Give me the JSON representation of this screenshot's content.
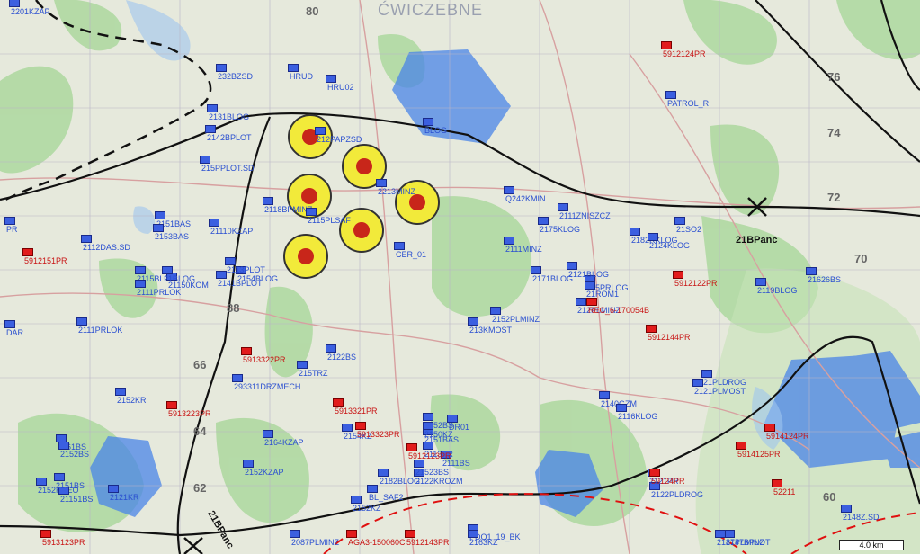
{
  "map": {
    "title_watermark": "ĆWICZEBNE",
    "grid_numbers": [
      "80",
      "76",
      "74",
      "72",
      "70",
      "88",
      "66",
      "64",
      "62",
      "60"
    ],
    "scale_label": "4.0 km"
  },
  "boundary_labels": {
    "right": "21BPanc",
    "bottom": "21BPanc"
  },
  "units_blue": [
    "2201KZAP",
    "232BZSD",
    "HRUD",
    "HRU02",
    "2131BLOG",
    "2142BPLOT",
    "215PPLOT.SD",
    "2151BAS",
    "2118BPMINZ",
    "2115PLSAF",
    "212PAPZSD",
    "2213MINZ",
    "BLOG",
    "CER_01",
    "Q242KMIN",
    "2175KLOG",
    "2111MINZ",
    "2182RKLOG",
    "2152PLMINZ",
    "213KMOST",
    "2112DAS.SD",
    "2153BAS",
    "21110KZAP",
    "2154BLOG",
    "2115BLOG",
    "2111PRLOK",
    "21150KOM",
    "2141BPLOT",
    "2122BS",
    "293311DRZMECH",
    "2152KR",
    "2161BS",
    "2152BS",
    "2164KZAP",
    "2154KZ",
    "2152KREO",
    "21151BS",
    "PATROL_R",
    "2111ZNISZCZ",
    "2121PLMOST",
    "2121KR",
    "2124KLOG",
    "2119BLOG",
    "21626BS",
    "21SO2",
    "21PLDROG",
    "2140GZM",
    "2151BAS",
    "2182BLOG",
    "212PLMINZ",
    "215PRLOG",
    "DAR",
    "PR",
    "21BLOG",
    "2116KLOG",
    "2113PR",
    "2121BLOG",
    "2171BLOG",
    "2122PLDROG",
    "2121PR",
    "2111BS",
    "2113PLOT",
    "21ROM1",
    "2147BPLOT",
    "2151BS",
    "2152BS",
    "2150KZ",
    "2122KROZM",
    "21523BS",
    "2111PRLOK",
    "215TRZ",
    "DR01",
    "BL_SAF2",
    "2152KZ",
    "PDO1_19_BK",
    "2187PLMINZ",
    "2087PLMINZ",
    "2148Z.SD",
    "2163KZ",
    "2152KZAP"
  ],
  "units_red": [
    "5912124PR",
    "5912151PR",
    "5913322PR",
    "5913223PR",
    "5913123PR",
    "5913321PR",
    "5913323PR",
    "5912123PR",
    "5912122PR",
    "5912144PR",
    "5914125PR",
    "52211",
    "5912143PR",
    "AGA3-150060C",
    "REC_6-170054B",
    "59124PR",
    "5914124PR"
  ]
}
